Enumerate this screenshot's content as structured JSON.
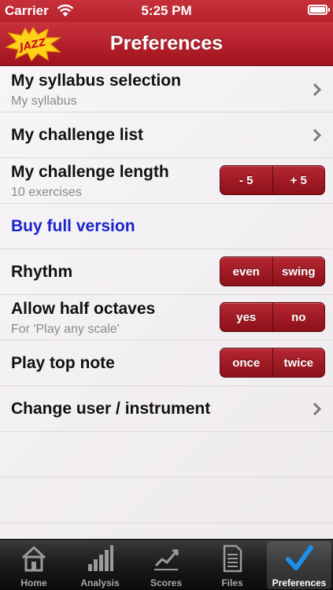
{
  "status_bar": {
    "carrier": "Carrier",
    "time": "5:25 PM"
  },
  "nav": {
    "logo_text": "JAZZ",
    "title": "Preferences"
  },
  "rows": {
    "syllabus": {
      "title": "My syllabus selection",
      "subtitle": "My syllabus"
    },
    "challenge_list": {
      "title": "My challenge list"
    },
    "challenge_length": {
      "title": "My challenge length",
      "subtitle": "10 exercises",
      "options": [
        "- 5",
        "+ 5"
      ]
    },
    "buy": {
      "title": "Buy full version"
    },
    "rhythm": {
      "title": "Rhythm",
      "options": [
        "even",
        "swing"
      ]
    },
    "half_octaves": {
      "title": "Allow half octaves",
      "subtitle": "For 'Play any scale'",
      "options": [
        "yes",
        "no"
      ]
    },
    "top_note": {
      "title": "Play top note",
      "options": [
        "once",
        "twice"
      ]
    },
    "change_user": {
      "title": "Change user / instrument"
    }
  },
  "tabs": [
    {
      "label": "Home",
      "icon": "home-icon"
    },
    {
      "label": "Analysis",
      "icon": "analysis-icon"
    },
    {
      "label": "Scores",
      "icon": "scores-icon"
    },
    {
      "label": "Files",
      "icon": "files-icon"
    },
    {
      "label": "Preferences",
      "icon": "checkmark-icon",
      "active": true
    }
  ],
  "colors": {
    "accent": "#b3202b",
    "link": "#1a23cc",
    "tab_active": "#1e8fe8"
  }
}
